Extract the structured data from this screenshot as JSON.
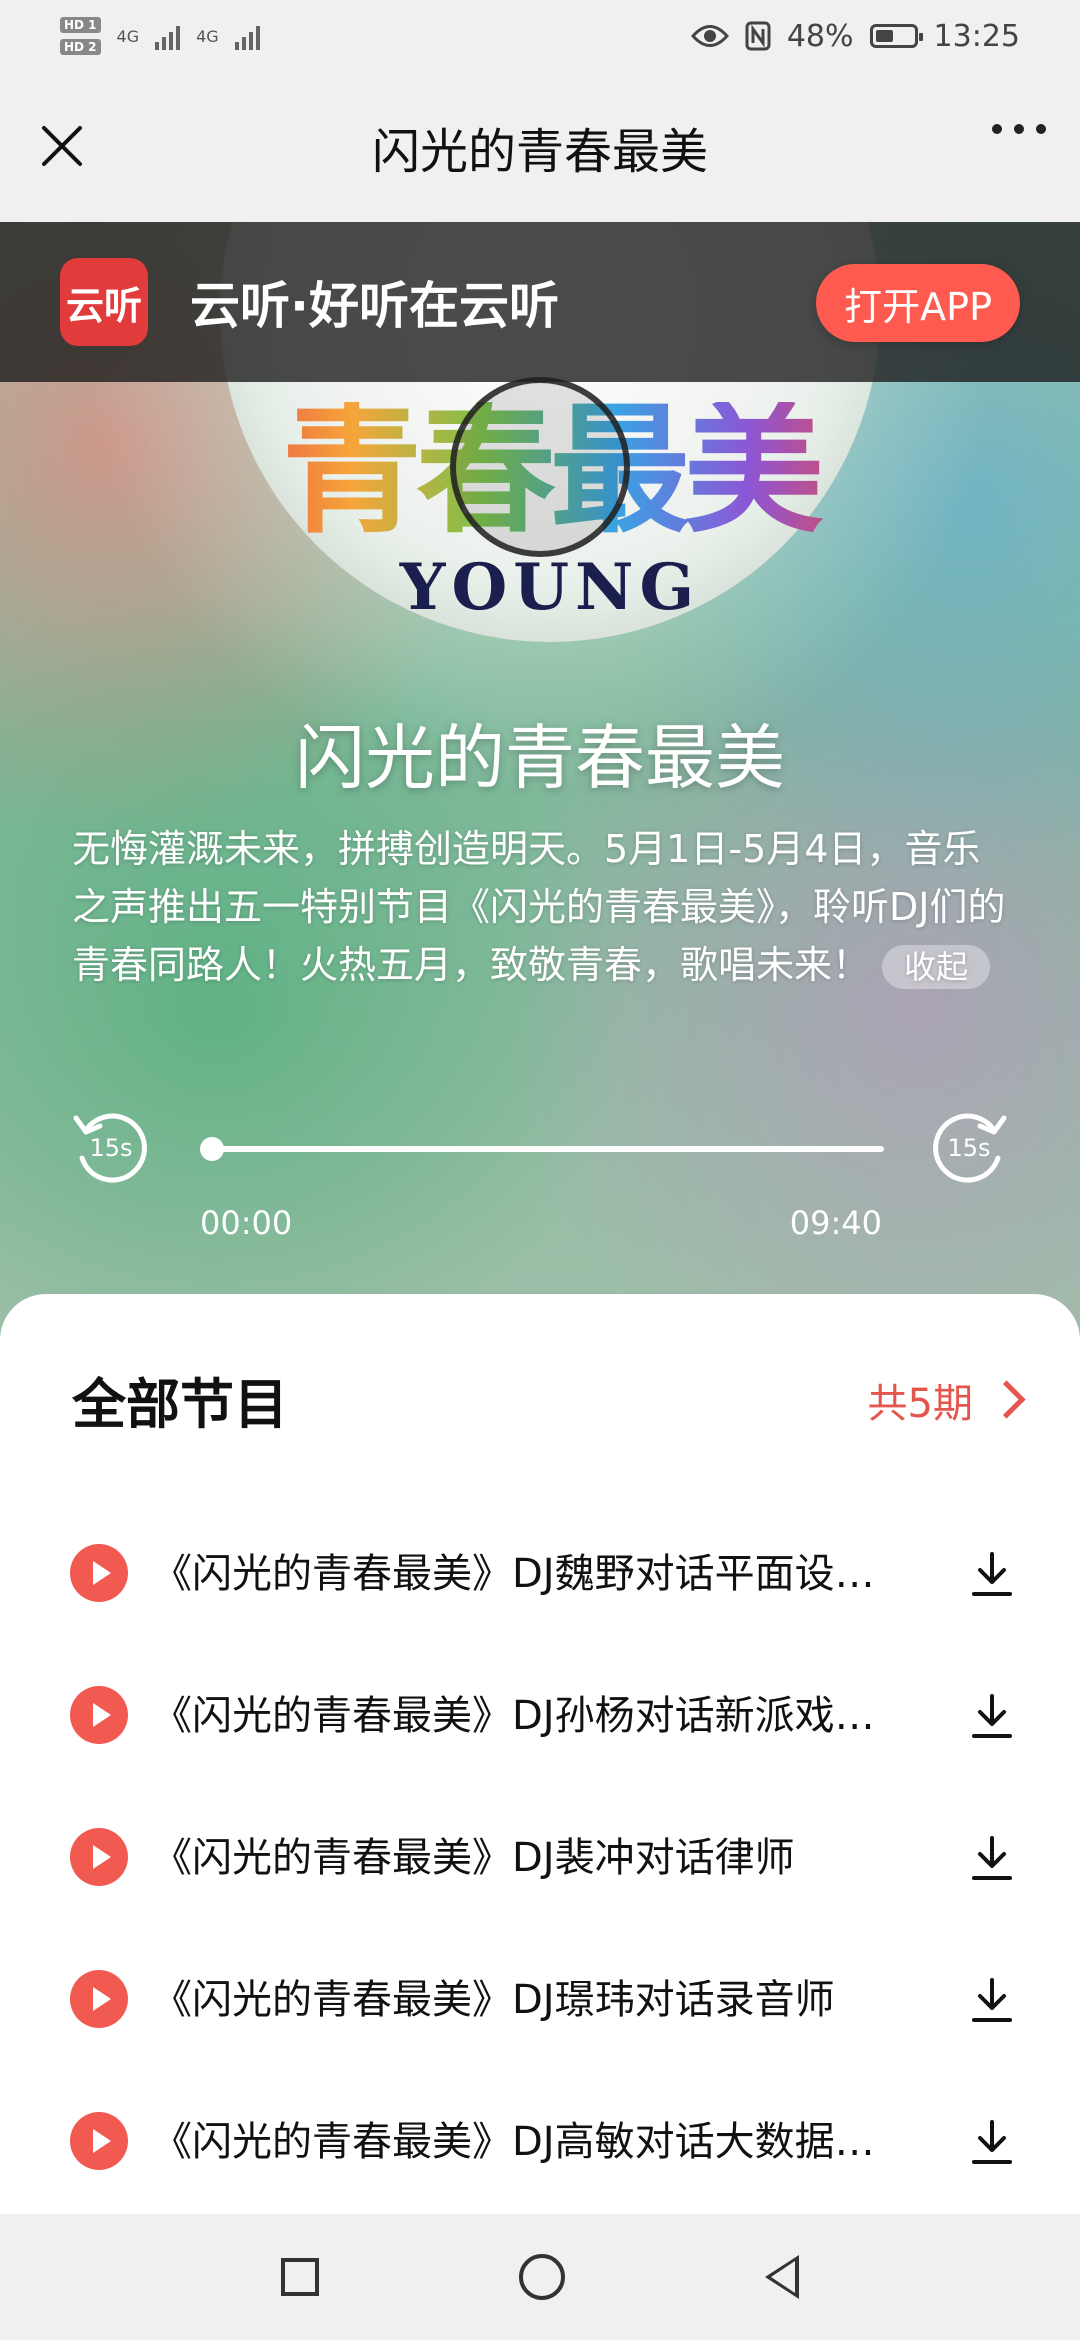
{
  "status_bar": {
    "time": "13:25",
    "battery_text": "48%",
    "battery_level": 0.48,
    "hd1": "HD 1",
    "hd2": "HD 2",
    "network1": "4G",
    "network2": "4G"
  },
  "header": {
    "title": "闪光的青春最美"
  },
  "banner": {
    "logo_text": "云听",
    "title": "云听·好听在云听",
    "open_app_label": "打开APP"
  },
  "album": {
    "art_text": "青春最美",
    "art_subtext": "YOUNG"
  },
  "program": {
    "title": "闪光的青春最美",
    "description": "无悔灌溉未来，拼搏创造明天。5月1日-5月4日，音乐之声推出五一特别节目《闪光的青春最美》，聆听DJ们的青春同路人！火热五月，致敬青春，歌唱未来！",
    "collapse_label": "收起"
  },
  "player": {
    "skip_back_label": "15s",
    "skip_fwd_label": "15s",
    "current_time": "00:00",
    "total_time": "09:40",
    "progress": 0.0
  },
  "episodes_section": {
    "title": "全部节目",
    "count_label": "共5期",
    "items": [
      {
        "title": "《闪光的青春最美》DJ魏野对话平面设…"
      },
      {
        "title": "《闪光的青春最美》DJ孙杨对话新派戏…"
      },
      {
        "title": "《闪光的青春最美》DJ裴冲对话律师"
      },
      {
        "title": "《闪光的青春最美》DJ璟玮对话录音师"
      },
      {
        "title": "《闪光的青春最美》DJ高敏对话大数据…"
      }
    ]
  },
  "colors": {
    "accent": "#e4564d",
    "brand_red": "#e23b3b",
    "open_app": "#ff5a4f"
  },
  "icons": {
    "close": "close-icon",
    "more": "more-icon",
    "skip_back": "rewind-15-icon",
    "skip_fwd": "forward-15-icon",
    "episode_play": "play-icon",
    "download": "download-icon",
    "chevron": "chevron-right-icon"
  }
}
